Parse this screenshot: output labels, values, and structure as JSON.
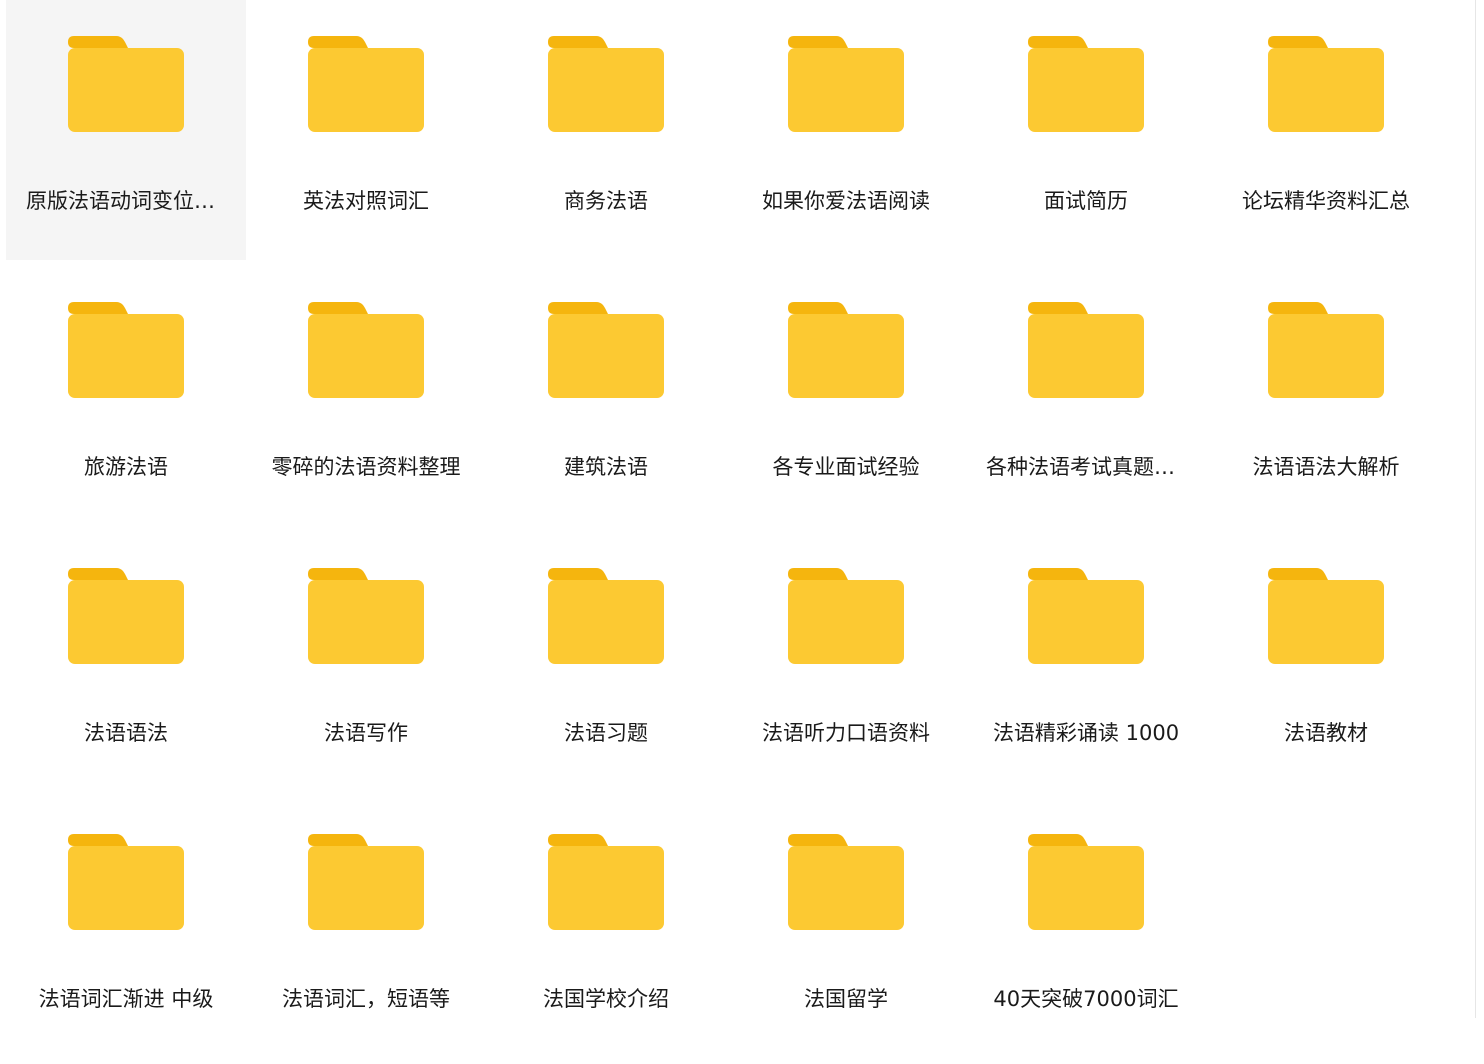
{
  "folders": [
    {
      "label": "原版法语动词变位大全",
      "selected": true
    },
    {
      "label": "英法对照词汇",
      "selected": false
    },
    {
      "label": "商务法语",
      "selected": false
    },
    {
      "label": "如果你爱法语阅读",
      "selected": false
    },
    {
      "label": "面试简历",
      "selected": false
    },
    {
      "label": "论坛精华资料汇总",
      "selected": false
    },
    {
      "label": "旅游法语",
      "selected": false
    },
    {
      "label": "零碎的法语资料整理",
      "selected": false
    },
    {
      "label": "建筑法语",
      "selected": false
    },
    {
      "label": "各专业面试经验",
      "selected": false
    },
    {
      "label": "各种法语考试真题汇编",
      "selected": false
    },
    {
      "label": "法语语法大解析",
      "selected": false
    },
    {
      "label": "法语语法",
      "selected": false
    },
    {
      "label": "法语写作",
      "selected": false
    },
    {
      "label": "法语习题",
      "selected": false
    },
    {
      "label": "法语听力口语资料",
      "selected": false
    },
    {
      "label": "法语精彩诵读 1000",
      "selected": false
    },
    {
      "label": "法语教材",
      "selected": false
    },
    {
      "label": "法语词汇渐进 中级",
      "selected": false
    },
    {
      "label": "法语词汇，短语等",
      "selected": false
    },
    {
      "label": "法国学校介绍",
      "selected": false
    },
    {
      "label": "法国留学",
      "selected": false
    },
    {
      "label": "40天突破7000词汇",
      "selected": false
    }
  ],
  "icon": "folder-icon",
  "colors": {
    "folder_body": "#FCC932",
    "folder_tab": "#F5B50E",
    "selected_bg": "#F5F5F5",
    "text": "#1A1A1A"
  }
}
